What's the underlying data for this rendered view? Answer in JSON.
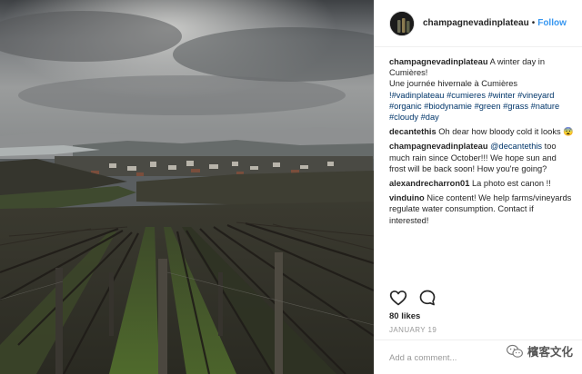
{
  "post": {
    "username": "champagnevadinplateau",
    "separator": "•",
    "follow_label": "Follow",
    "caption": {
      "username": "champagnevadinplateau",
      "text_line1": "A winter day in Cumières!",
      "text_line2": "Une journée hivernale à Cumières",
      "hashtags": [
        "!#vadinplateau",
        "#cumieres",
        "#winter",
        "#vineyard",
        "#organic",
        "#biodynamie",
        "#green",
        "#grass",
        "#nature",
        "#cloudy",
        "#day"
      ]
    },
    "comments": [
      {
        "username": "decantethis",
        "text": "Oh dear how bloody cold it looks 😨"
      },
      {
        "username": "champagnevadinplateau",
        "mention": "@decantethis",
        "text": " too much rain since October!!! We hope sun and frost will be back soon! How you're going?"
      },
      {
        "username": "alexandrecharron01",
        "text": "La photo est canon !!"
      },
      {
        "username": "vinduino",
        "text": "Nice content! We help farms/vineyards regulate water consumption. Contact if interested!"
      }
    ],
    "likes": "80 likes",
    "date": "JANUARY 19",
    "comment_placeholder": "Add a comment...",
    "icons": {
      "like": "heart-icon",
      "comment": "comment-bubble-icon"
    }
  },
  "watermark": {
    "text": "檳客文化",
    "icon": "wechat-icon"
  }
}
